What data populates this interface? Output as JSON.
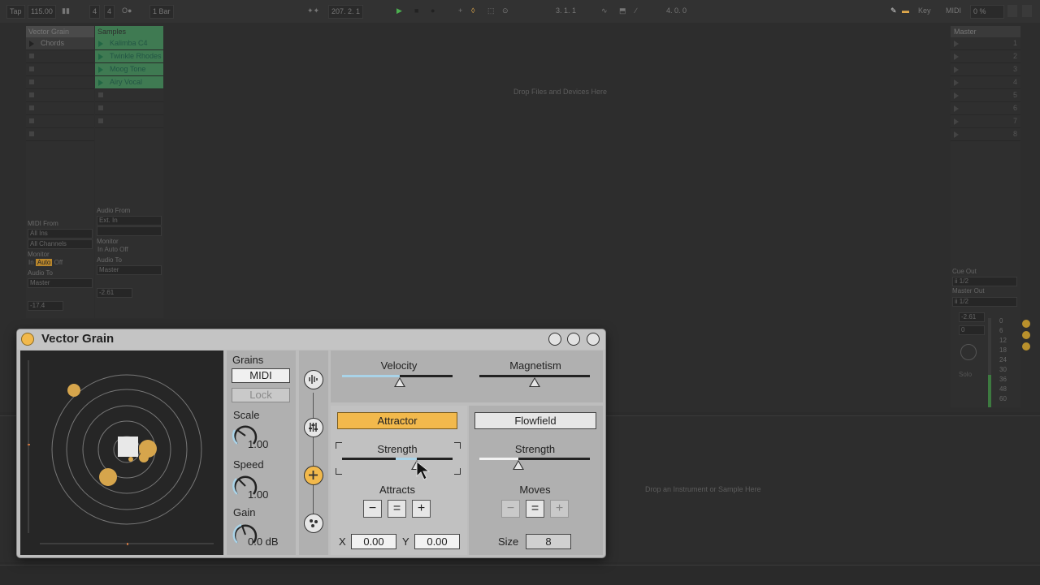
{
  "transport": {
    "tap": "Tap",
    "tempo": "115.00",
    "signature_num": "4",
    "signature_den": "4",
    "quantize": "1 Bar",
    "position": "207.  2.  1",
    "loop_start": "3.  1.  1",
    "loop_length": "4.  0.  0",
    "key": "Key",
    "midi": "MIDI",
    "cpu": "0 %"
  },
  "session": {
    "tracks": [
      {
        "name": "Vector Grain",
        "color": "#4a4a4a",
        "clips": [
          "Chords"
        ]
      },
      {
        "name": "Samples",
        "color": "#3f7a52",
        "clips": [
          "Kalimba C4",
          "Twinkle Rhodes",
          "Moog Tone",
          "Airy Vocal"
        ]
      }
    ],
    "drop_files": "Drop Files and Devices Here",
    "io": {
      "midi_from": "MIDI From",
      "midi_from_val": "All Ins",
      "channels": "All Channels",
      "audio_from": "Audio From",
      "audio_from_val": "Ext. In",
      "monitor": "Monitor",
      "mon_in": "In",
      "mon_auto": "Auto",
      "mon_off": "Off",
      "audio_to": "Audio To",
      "audio_to_val": "Master",
      "vol1": "-17.4",
      "vol2": "-2.61"
    },
    "master": {
      "name": "Master",
      "scenes": [
        "1",
        "2",
        "3",
        "4",
        "5",
        "6",
        "7",
        "8"
      ],
      "cue_out": "Cue Out",
      "cue_out_val": "ii 1/2",
      "master_out": "Master Out",
      "master_out_val": "ii 1/2",
      "vol": "-2.61",
      "pan": "0",
      "solo": "Solo",
      "db_scale": [
        "0",
        "6",
        "12",
        "18",
        "24",
        "30",
        "36",
        "48",
        "60"
      ]
    },
    "drop_instrument": "Drop an Instrument or Sample Here"
  },
  "plugin": {
    "title": "Vector Grain",
    "grains_label": "Grains",
    "midi_button": "MIDI",
    "lock_button": "Lock",
    "scale_label": "Scale",
    "scale_value": "1.00",
    "speed_label": "Speed",
    "speed_value": "1.00",
    "gain_label": "Gain",
    "gain_value": "0.0 dB",
    "velocity_label": "Velocity",
    "velocity_level": 0.52,
    "magnetism_label": "Magnetism",
    "magnetism_level": 0.5,
    "attractor_button": "Attractor",
    "flowfield_button": "Flowfield",
    "strength_label": "Strength",
    "attr_strength_level": 0.68,
    "flow_strength_level": 0.35,
    "attracts_label": "Attracts",
    "moves_label": "Moves",
    "minus": "−",
    "equal": "=",
    "plus": "+",
    "x_label": "X",
    "x_value": "0.00",
    "y_label": "Y",
    "y_value": "0.00",
    "size_label": "Size",
    "size_value": "8",
    "accent_color": "#f2b94c"
  }
}
